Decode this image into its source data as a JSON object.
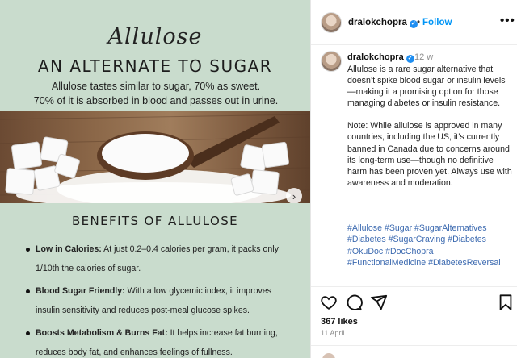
{
  "post_image": {
    "script_title": "Allulose",
    "main_title": "AN ALTERNATE TO SUGAR",
    "intro_line1": "Allulose tastes similar to sugar, 70% as sweet.",
    "intro_line2": "70% of it is absorbed in blood and passes out in urine.",
    "benefits_title": "BENEFITS OF ALLULOSE",
    "benefits": [
      {
        "bold": "Low in Calories:",
        "text": " At just 0.2–0.4 calories per gram, it packs only 1/10th the calories of sugar."
      },
      {
        "bold": "Blood Sugar Friendly:",
        "text": " With a low glycemic index, it improves insulin sensitivity and reduces post-meal glucose spikes."
      },
      {
        "bold": "Boosts Metabolism & Burns Fat:",
        "text": " It helps increase fat burning, reduces body fat, and enhances feelings of fullness."
      }
    ],
    "next_icon": "chevron-right-icon"
  },
  "header": {
    "username": "dralokchopra",
    "verified_icon": "verified-badge-icon",
    "follow_label": "Follow",
    "more_icon": "more-options-icon"
  },
  "caption": {
    "username": "dralokchopra",
    "time": "12 w",
    "paragraph1": "Allulose is a rare sugar alternative that doesn’t spike blood sugar or insulin levels—making it a promising option for those managing diabetes or insulin resistance.",
    "paragraph2": "Note: While allulose is approved in many countries, including the US, it’s currently banned in Canada due to concerns around its long-term use—though no definitive harm has been proven yet. Always use with awareness and moderation.",
    "hashtags": "#Allulose #Sugar #SugarAlternatives #Diabetes #SugarCraving #Diabetes #OkuDoc #DocChopra #FunctionalMedicine #DiabetesReversal"
  },
  "actions": {
    "like_icon": "heart-icon",
    "comment_icon": "comment-icon",
    "share_icon": "send-icon",
    "save_icon": "bookmark-icon",
    "likes": "367 likes",
    "date": "11 April"
  },
  "colors": {
    "image_bg": "#c9dccd",
    "link_blue": "#0095f6",
    "hashtag_blue": "#3c6ab0",
    "verified_blue": "#1f8ef1"
  }
}
